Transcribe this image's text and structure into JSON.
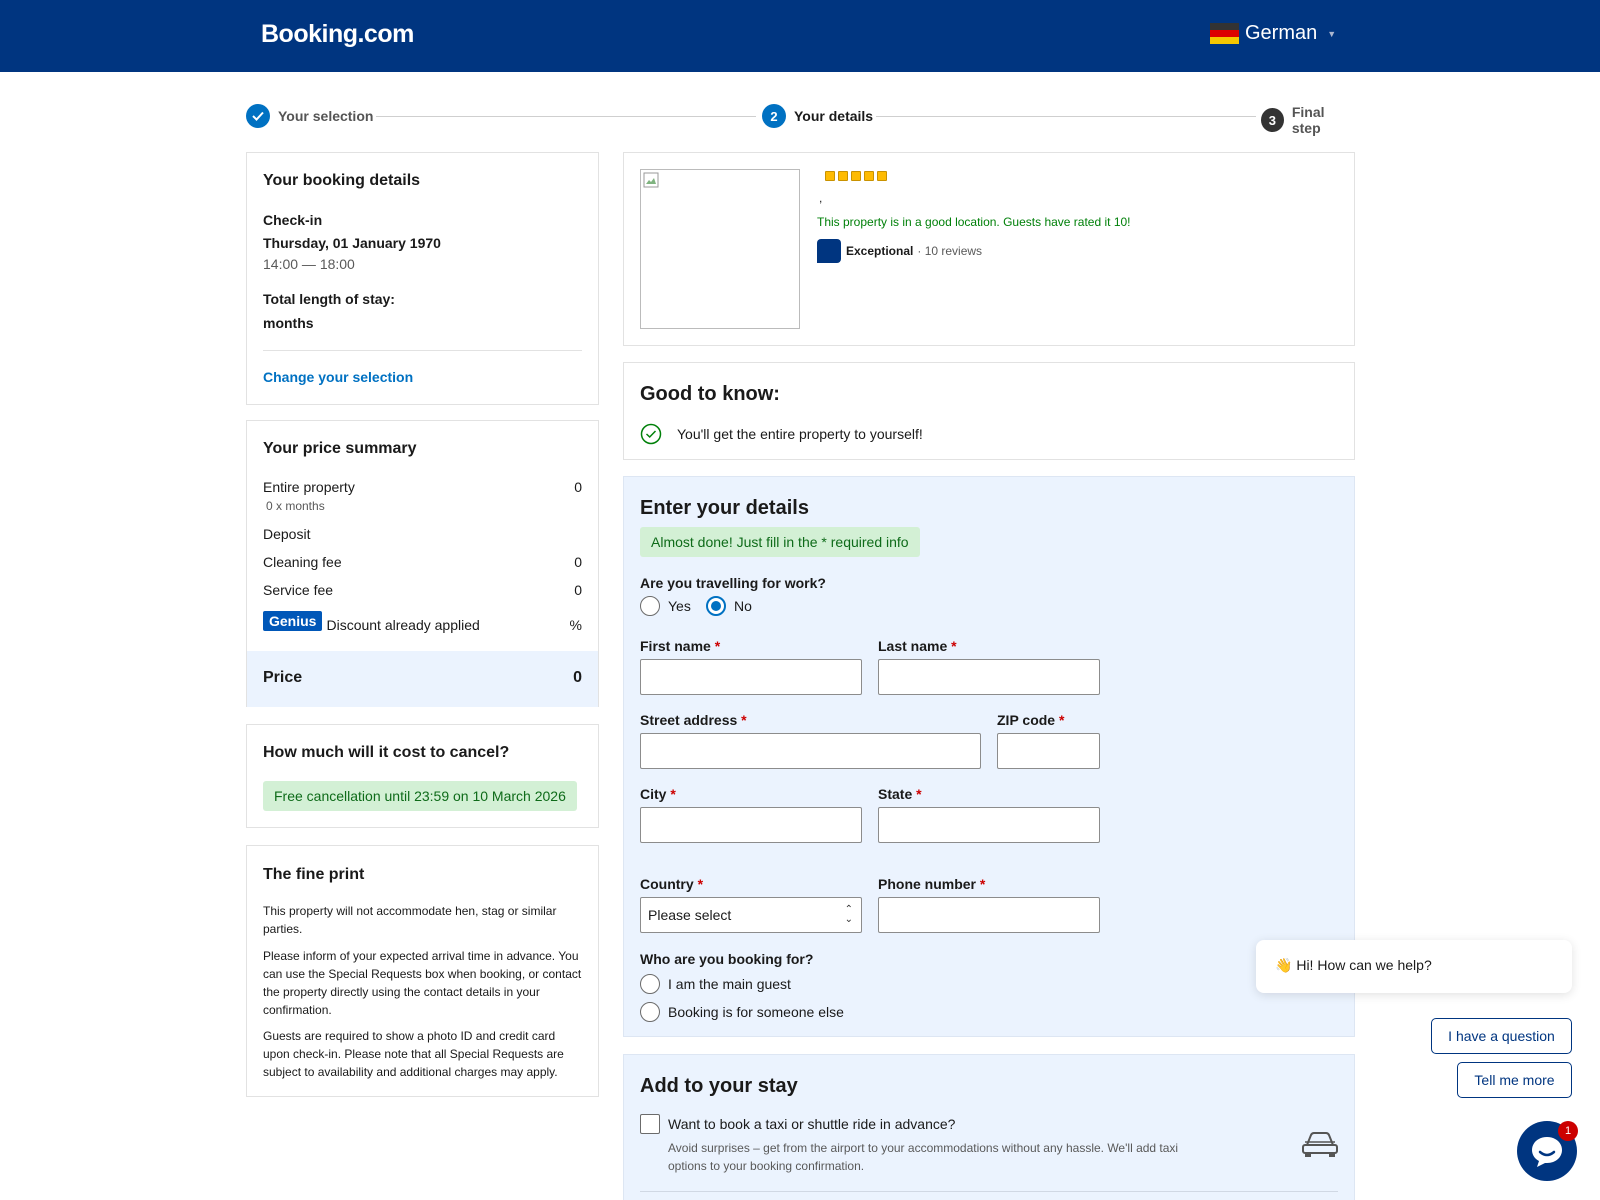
{
  "header": {
    "logo": "Booking.com",
    "language": "German",
    "colors": {
      "brand": "#003580",
      "accent": "#0071c2",
      "success": "#0e6b19"
    }
  },
  "steps": [
    {
      "label": "Your selection",
      "icon": "check-icon"
    },
    {
      "number": "2",
      "label": "Your details"
    },
    {
      "number": "3",
      "label": "Final step"
    }
  ],
  "booking_details": {
    "title": "Your booking details",
    "checkin_label": "Check-in",
    "checkin_date": "Thursday, 01 January 1970",
    "checkin_time": "14:00 — 18:00",
    "stay_label": "Total length of stay:",
    "stay_value": "months",
    "change_link": "Change your selection"
  },
  "price_summary": {
    "title": "Your price summary",
    "items": [
      {
        "label": "Entire property",
        "value": "0",
        "sub": "0 x  months"
      },
      {
        "label": "Deposit",
        "value": ""
      },
      {
        "label": "Cleaning fee",
        "value": "0"
      },
      {
        "label": "Service fee",
        "value": "0"
      }
    ],
    "genius_badge": "Genius",
    "genius_text": "Discount already applied",
    "genius_value": "%",
    "total_label": "Price",
    "total_value": "0"
  },
  "cancel": {
    "title": "How much will it cost to cancel?",
    "note": "Free cancellation until 23:59 on 10 March 2026"
  },
  "fine_print": {
    "title": "The fine print",
    "paragraphs": [
      "This property will not accommodate hen, stag or similar parties.",
      "Please inform of your expected arrival time in advance. You can use the Special Requests box when booking, or contact the property directly using the contact details in your confirmation.",
      "Guests are required to show a photo ID and credit card upon check-in. Please note that all Special Requests are subject to availability and additional charges may apply."
    ]
  },
  "property": {
    "star_count": 5,
    "address": ",",
    "location_note": "This property is in a good location. Guests have rated it 10!",
    "score_word": "Exceptional",
    "reviews": "· 10 reviews"
  },
  "good_to_know": {
    "title": "Good to know:",
    "item": "You'll get the entire property to yourself!"
  },
  "details_form": {
    "title": "Enter your details",
    "notice": "Almost done! Just fill in the * required info",
    "work_question": "Are you travelling for work?",
    "work_options": [
      "Yes",
      "No"
    ],
    "work_selected": "No",
    "required_mark": "*",
    "fields": {
      "first_name": "First name",
      "last_name": "Last name",
      "street": "Street address",
      "zip": "ZIP code",
      "city": "City",
      "state": "State",
      "country": "Country",
      "phone": "Phone number"
    },
    "country_value": "Please select",
    "booking_for_question": "Who are you booking for?",
    "booking_for_options": [
      "I am the main guest",
      "Booking is for someone else"
    ]
  },
  "add_to_stay": {
    "title": "Add to your stay",
    "taxi_label": "Want to book a taxi or shuttle ride in advance?",
    "taxi_desc": "Avoid surprises – get from the airport to your accommodations without any hassle. We'll add taxi options to your booking confirmation."
  },
  "chat": {
    "greeting": "Hi! How can we help?",
    "wave": "👋",
    "question_button": "I have a question",
    "more_button": "Tell me more",
    "badge": "1"
  }
}
